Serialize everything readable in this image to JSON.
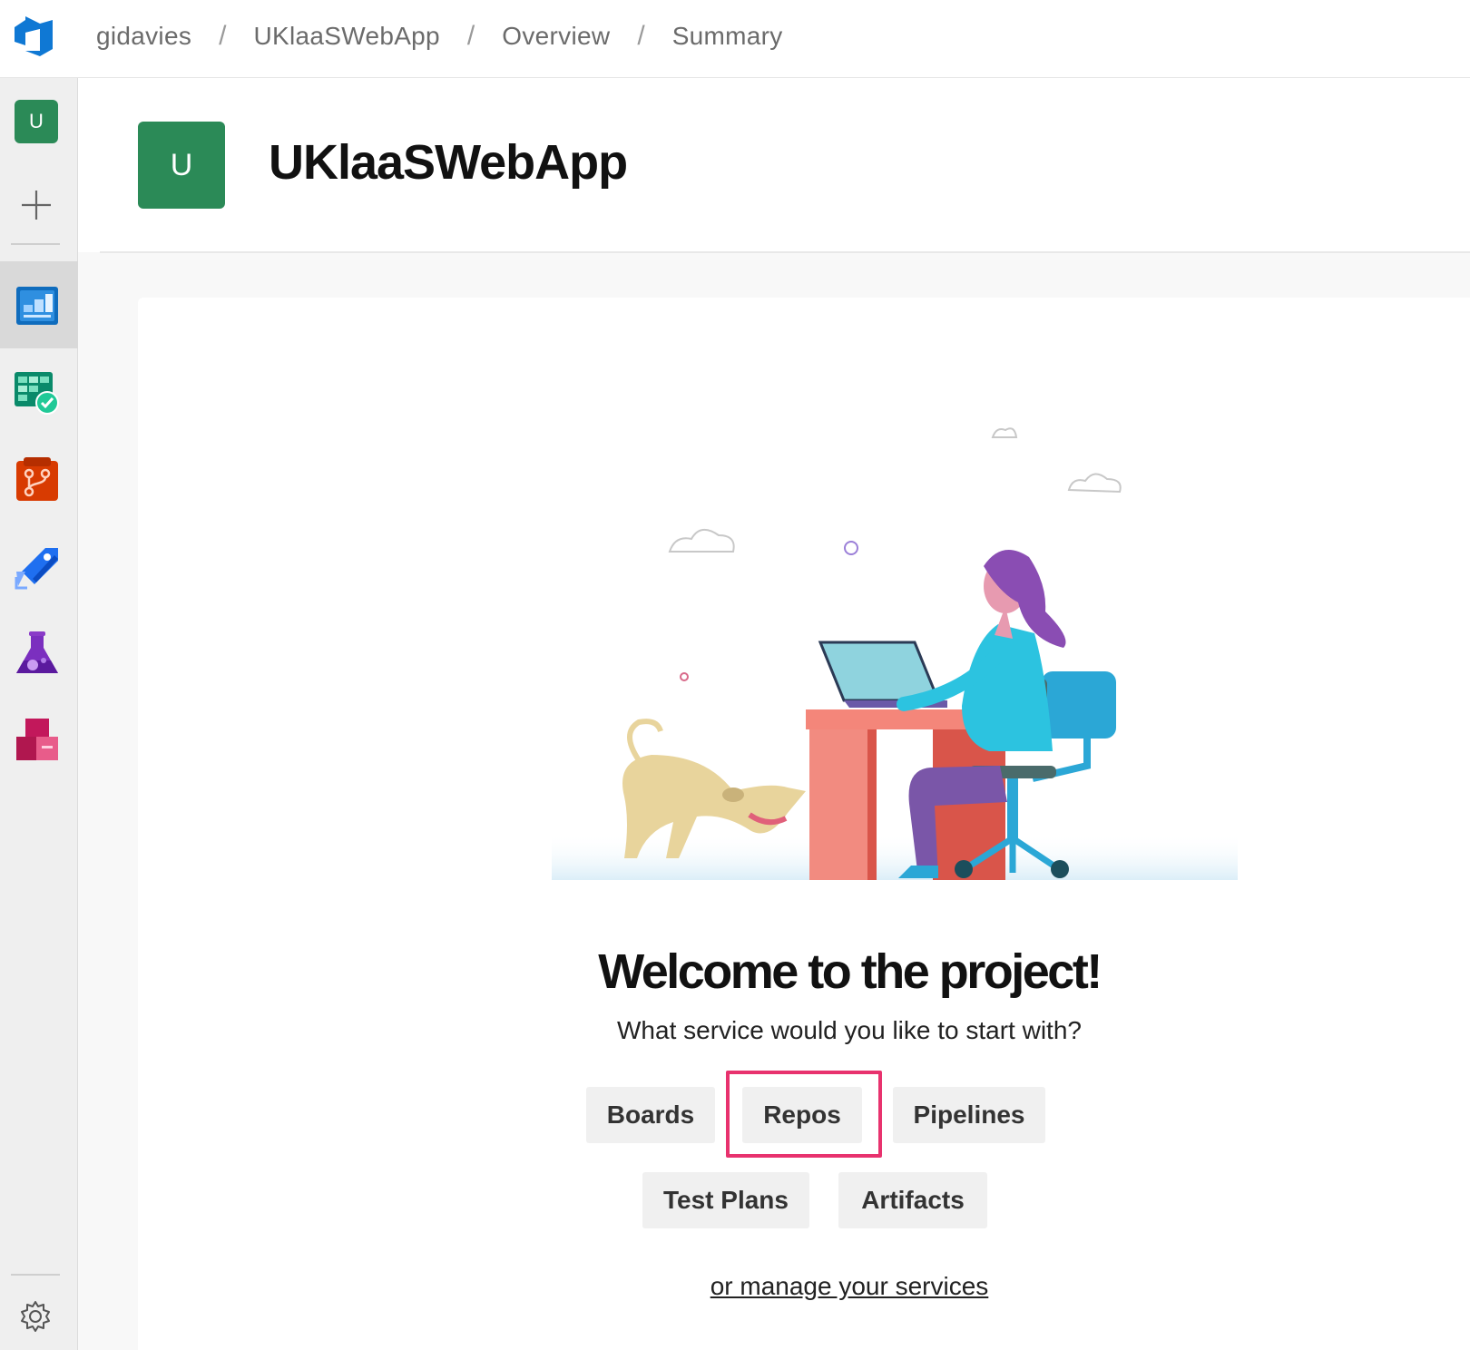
{
  "breadcrumb": {
    "org": "gidavies",
    "project": "UKlaaSWebApp",
    "section": "Overview",
    "page": "Summary",
    "separator": "/"
  },
  "rail": {
    "project_initial": "U",
    "items": [
      {
        "name": "overview",
        "icon": "overview-icon",
        "active": true
      },
      {
        "name": "boards",
        "icon": "boards-icon",
        "active": false
      },
      {
        "name": "repos",
        "icon": "repos-icon",
        "active": false
      },
      {
        "name": "pipelines",
        "icon": "pipelines-icon",
        "active": false
      },
      {
        "name": "test-plans",
        "icon": "test-plans-icon",
        "active": false
      },
      {
        "name": "artifacts",
        "icon": "artifacts-icon",
        "active": false
      }
    ]
  },
  "project": {
    "initial": "U",
    "title": "UKlaaSWebApp",
    "tile_color": "#2b8a57"
  },
  "welcome": {
    "heading": "Welcome to the project!",
    "subtitle": "What service would you like to start with?",
    "services": [
      "Boards",
      "Repos",
      "Pipelines",
      "Test Plans",
      "Artifacts"
    ],
    "highlighted": "Repos",
    "highlight_color": "#e8326e",
    "manage_link": "or manage your services"
  }
}
